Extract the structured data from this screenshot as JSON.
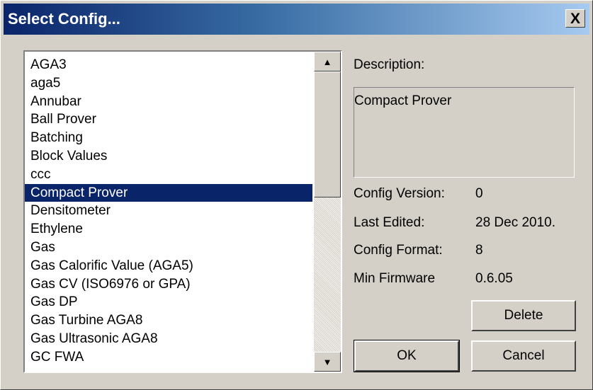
{
  "window": {
    "title": "Select Config...",
    "close_label": "X"
  },
  "list": {
    "items": [
      {
        "label": "AGA3"
      },
      {
        "label": "aga5"
      },
      {
        "label": "Annubar"
      },
      {
        "label": "Ball Prover"
      },
      {
        "label": "Batching"
      },
      {
        "label": "Block Values"
      },
      {
        "label": "ccc"
      },
      {
        "label": "Compact Prover",
        "selected": true
      },
      {
        "label": "Densitometer"
      },
      {
        "label": "Ethylene"
      },
      {
        "label": "Gas"
      },
      {
        "label": "Gas Calorific Value (AGA5)"
      },
      {
        "label": "Gas CV (ISO6976 or GPA)"
      },
      {
        "label": "Gas DP"
      },
      {
        "label": "Gas Turbine AGA8"
      },
      {
        "label": "Gas Ultrasonic AGA8"
      },
      {
        "label": "GC FWA"
      }
    ],
    "scroll_up_icon": "arrow-up-icon",
    "scroll_down_icon": "arrow-down-icon"
  },
  "details": {
    "description_label": "Description:",
    "description_value": "Compact Prover",
    "config_version_label": "Config Version:",
    "config_version_value": "0",
    "last_edited_label": "Last Edited:",
    "last_edited_value": "28 Dec 2010.",
    "config_format_label": "Config Format:",
    "config_format_value": "8",
    "min_firmware_label": "Min Firmware",
    "min_firmware_value": "0.6.05"
  },
  "buttons": {
    "delete": "Delete",
    "ok": "OK",
    "cancel": "Cancel"
  },
  "colors": {
    "face": "#d4d0c8",
    "title_start": "#0a246a",
    "title_end": "#a6caf0",
    "selection": "#0a246a"
  }
}
